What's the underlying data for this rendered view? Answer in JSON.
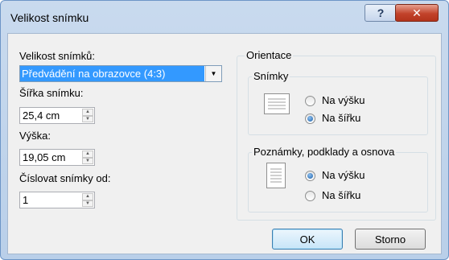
{
  "window": {
    "title": "Velikost snímku"
  },
  "titlebar": {
    "help_symbol": "?",
    "close_symbol": "✕"
  },
  "slide_size": {
    "label": "Velikost snímků:",
    "selected": "Předvádění na obrazovce (4:3)"
  },
  "width": {
    "label": "Šířka snímku:",
    "value": "25,4 cm"
  },
  "height": {
    "label": "Výška:",
    "value": "19,05 cm"
  },
  "numbering": {
    "label": "Číslovat snímky od:",
    "value": "1"
  },
  "orientation": {
    "title": "Orientace",
    "slides": {
      "title": "Snímky",
      "options": [
        {
          "label": "Na výšku",
          "checked": false
        },
        {
          "label": "Na šířku",
          "checked": true
        }
      ]
    },
    "notes": {
      "title": "Poznámky, podklady a osnova",
      "options": [
        {
          "label": "Na výšku",
          "checked": true
        },
        {
          "label": "Na šířku",
          "checked": false
        }
      ]
    }
  },
  "buttons": {
    "ok": "OK",
    "cancel": "Storno"
  },
  "icons": {
    "dropdown": "chevron-down-icon",
    "spin": "spin-updown-icon"
  }
}
